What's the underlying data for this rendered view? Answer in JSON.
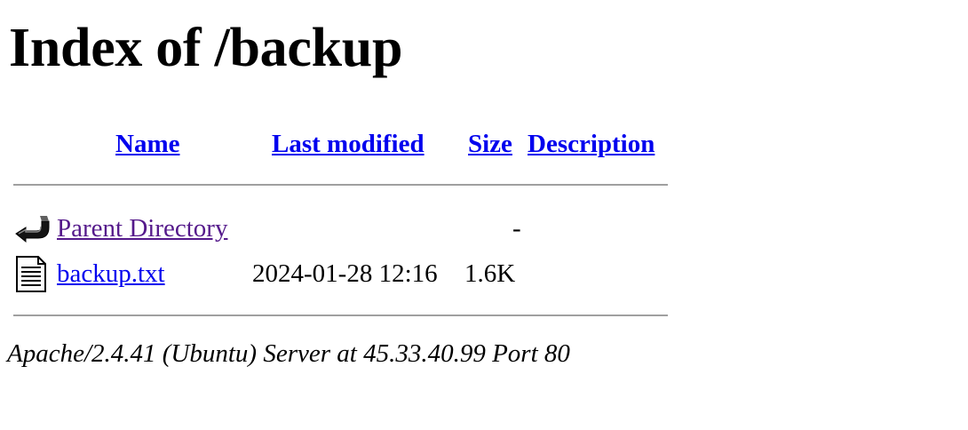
{
  "page": {
    "title": "Index of /backup"
  },
  "table": {
    "headers": {
      "name": "Name",
      "last_modified": "Last modified",
      "size": "Size",
      "description": "Description"
    },
    "rows": [
      {
        "icon": "back-arrow-icon",
        "name": "Parent Directory",
        "last_modified": "",
        "size": "-",
        "description": ""
      },
      {
        "icon": "text-file-icon",
        "name": "backup.txt",
        "last_modified": "2024-01-28 12:16",
        "size": "1.6K",
        "description": ""
      }
    ]
  },
  "footer": {
    "server_signature": "Apache/2.4.41 (Ubuntu) Server at 45.33.40.99 Port 80"
  },
  "colors": {
    "link": "#0000ee",
    "visited_link": "#551a8b",
    "rule": "#a0a0a0",
    "background": "#ffffff"
  }
}
